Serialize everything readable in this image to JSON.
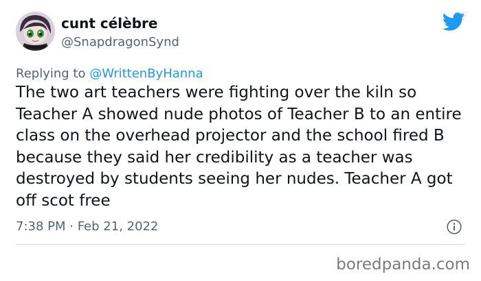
{
  "tweet": {
    "author": {
      "display_name": "cunt célèbre",
      "handle": "@SnapdragonSynd",
      "avatar_icon": "anime-character-avatar"
    },
    "reply": {
      "prefix": "Replying to ",
      "mention": "@WrittenByHanna"
    },
    "text": "The two art teachers were fighting over the kiln so Teacher A showed nude photos of Teacher B to an entire class on the overhead projector and the school fired B because they said her credibility as a teacher was destroyed by students seeing her nudes. Teacher A got off scot free",
    "timestamp": "7:38 PM · Feb 21, 2022",
    "icons": {
      "brand": "twitter-bird-icon",
      "info": "info-icon"
    }
  },
  "watermark": "boredpanda.com",
  "colors": {
    "text": "#0f1419",
    "secondary": "#536471",
    "accent": "#1d9bf0",
    "divider": "#cfd9de",
    "watermark": "#7b7b7b"
  }
}
